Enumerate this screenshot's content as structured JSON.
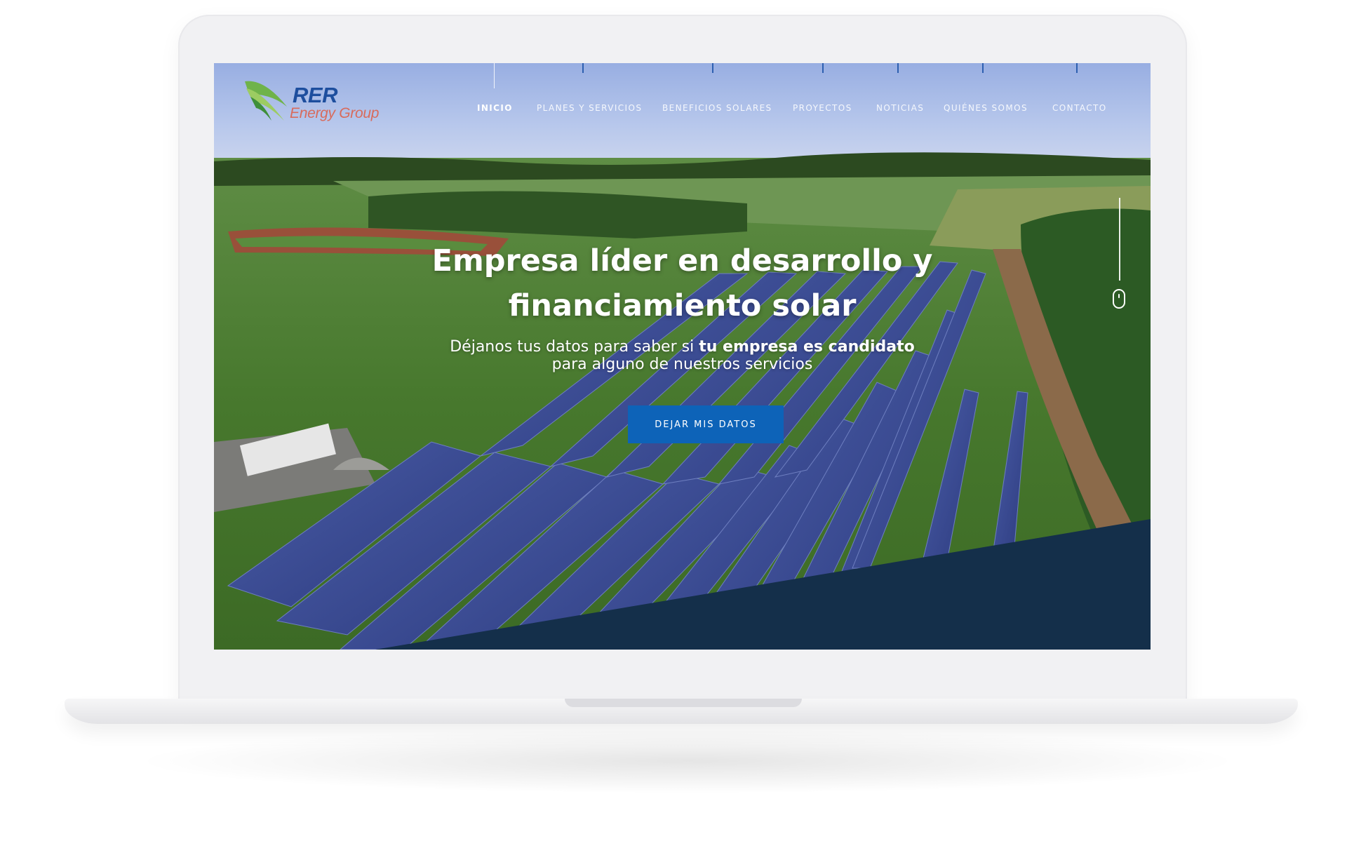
{
  "brand": {
    "name": "RER",
    "tagline": "Energy Group"
  },
  "nav": {
    "items": [
      {
        "label": "INICIO",
        "active": true
      },
      {
        "label": "PLANES Y SERVICIOS",
        "active": false
      },
      {
        "label": "BENEFICIOS SOLARES",
        "active": false
      },
      {
        "label": "PROYECTOS",
        "active": false
      },
      {
        "label": "NOTICIAS",
        "active": false
      },
      {
        "label": "QUIÉNES SOMOS",
        "active": false
      },
      {
        "label": "CONTACTO",
        "active": false
      }
    ]
  },
  "hero": {
    "title_part1": "Empresa ",
    "title_bold1": "líder en desarrollo y",
    "title_bold2": "financiamiento",
    "title_part2": " solar",
    "subtitle_part1": "Déjanos tus datos para saber si ",
    "subtitle_bold": "tu empresa es candidato",
    "subtitle_part2": "para alguno de nuestros servicios",
    "cta_label": "DEJAR MIS DATOS"
  },
  "icons": {
    "logo_mark": "green-swoosh-logo-icon",
    "scroll": "mouse-scroll-icon"
  },
  "colors": {
    "primary_button": "#0d63b8",
    "logo_blue": "#1d4e9e",
    "logo_red": "#d86b5c",
    "bottom_band": "#142f4a"
  }
}
